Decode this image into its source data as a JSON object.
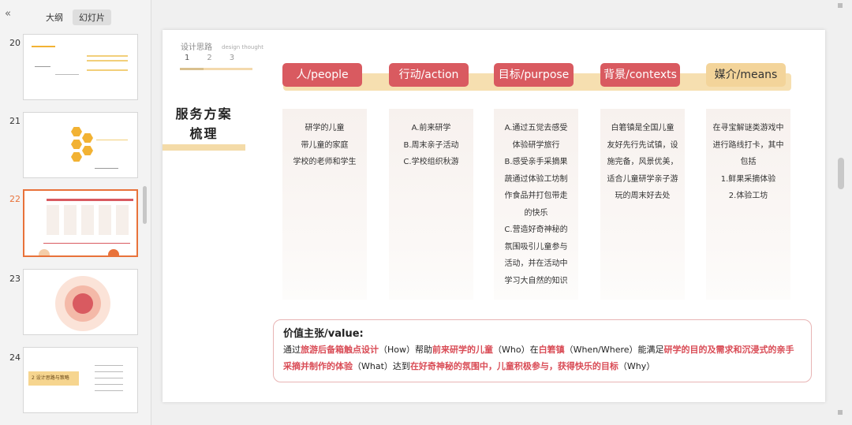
{
  "sidebar": {
    "collapse_icon": "«",
    "tabs": [
      "大纲",
      "幻灯片"
    ],
    "slides": [
      {
        "num": "20"
      },
      {
        "num": "21"
      },
      {
        "num": "22"
      },
      {
        "num": "23"
      },
      {
        "num": "24",
        "caption": "2 设计思路与策略"
      }
    ]
  },
  "slide": {
    "design_label": "设计思路",
    "design_label_en": "design thought",
    "steps": [
      "1",
      "2",
      "3"
    ],
    "side_title_line1": "服务方案",
    "side_title_line2": "梳理",
    "columns": [
      {
        "head": "人/people",
        "text": "研学的儿童\n带儿童的家庭\n学校的老师和学生"
      },
      {
        "head": "行动/action",
        "text": "A.前来研学\nB.周末亲子活动\nC.学校组织秋游"
      },
      {
        "head": "目标/purpose",
        "text": "A.通过五觉去感受\n体验研学旅行\nB.感受亲手采摘果\n蔬通过体验工坊制\n作食品并打包带走\n的快乐\nC.营造好奇神秘的\n氛围吸引儿童参与\n活动，并在活动中\n学习大自然的知识"
      },
      {
        "head": "背景/contexts",
        "text": "白箬镇是全国儿童\n友好先行先试镇，设\n施完备，风景优美，\n适合儿童研学亲子游\n玩的周末好去处"
      },
      {
        "head": "媒介/means",
        "text": "在寻宝解谜类游戏中\n进行路线打卡，其中\n包括\n1.鲜果采摘体验\n2.体验工坊"
      }
    ],
    "value": {
      "title": "价值主张/value:",
      "p1": "通过",
      "h1": "旅游后备箱触点设计",
      "p2": "（How）帮助",
      "h2": "前来研学的儿童",
      "p3": "（Who）在",
      "h3": "白箬镇",
      "p4": "（When/Where）能满足",
      "h4": "研学的目的及需求和沉浸式的亲手采摘并制作的体验",
      "p5": "（What）达到",
      "h5": "在好奇神秘的氛围中，儿童积极参与，获得快乐的目标",
      "p6": "（Why）"
    }
  },
  "colors": {
    "accent": "#d95a60",
    "accent_alt": "#f3d49a",
    "highlight": "#d94b55",
    "active_thumb": "#e8723a"
  }
}
